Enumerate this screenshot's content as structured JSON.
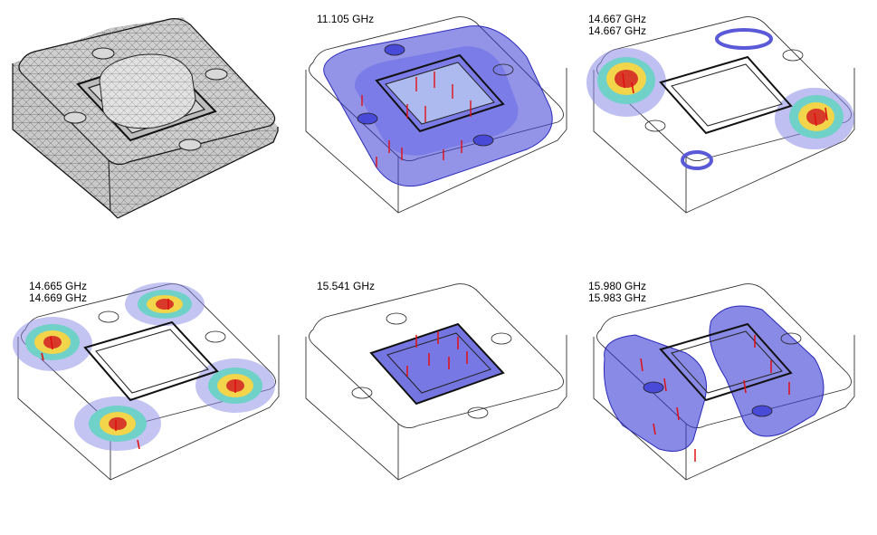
{
  "panels": [
    {
      "id": "mesh",
      "labels": []
    },
    {
      "id": "mode-1",
      "labels": [
        "11.105 GHz"
      ]
    },
    {
      "id": "mode-2",
      "labels": [
        "14.667 GHz",
        "14.667 GHz"
      ]
    },
    {
      "id": "mode-3",
      "labels": [
        "14.665 GHz",
        "14.669 GHz"
      ]
    },
    {
      "id": "mode-4",
      "labels": [
        "15.541 GHz"
      ]
    },
    {
      "id": "mode-5",
      "labels": [
        "15.980 GHz",
        "15.983 GHz"
      ]
    }
  ],
  "colors": {
    "wire": "#333333",
    "field_blue": "#3a3ad6",
    "arrow": "#e01010",
    "hot": "#d83a2a",
    "warm": "#f2d54a",
    "cool": "#6fd1c8"
  }
}
